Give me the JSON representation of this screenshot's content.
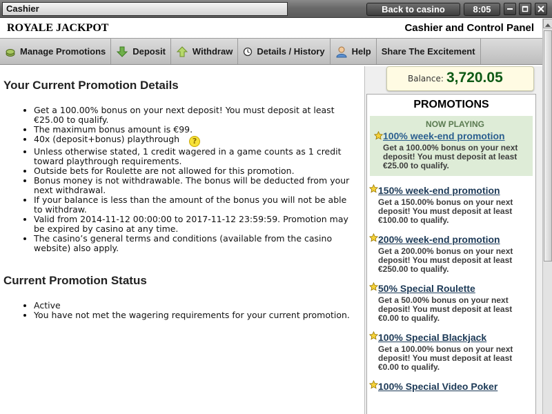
{
  "window": {
    "title": "Cashier",
    "back_button": "Back to casino",
    "time": "8:05"
  },
  "header": {
    "brand": "ROYALE JACKPOT",
    "panel_title": "Cashier and Control Panel"
  },
  "nav": {
    "items": [
      {
        "label": "Manage Promotions",
        "icon": "coins-icon"
      },
      {
        "label": "Deposit",
        "icon": "arrow-down-icon"
      },
      {
        "label": "Withdraw",
        "icon": "arrow-up-icon"
      },
      {
        "label": "Details / History",
        "icon": "clock-icon"
      },
      {
        "label": "Help",
        "icon": "person-help-icon"
      },
      {
        "label": "Share The Excitement",
        "icon": ""
      }
    ]
  },
  "main": {
    "current_heading": "Your Current Promotion Details",
    "details": [
      "Get a 100.00% bonus on your next deposit! You must deposit at least €25.00 to qualify.",
      "The maximum bonus amount is €99.",
      "40x (deposit+bonus) playthrough",
      "Unless otherwise stated, 1 credit wagered in a game counts as 1 credit toward playthrough requirements.",
      "Outside bets for Roulette are not allowed for this promotion.",
      "Bonus money is not withdrawable. The bonus will be deducted from your next withdrawal.",
      "If your balance is less than the amount of the bonus you will not be able to withdraw.",
      "Valid from 2014-11-12 00:00:00 to 2017-11-12 23:59:59. Promotion may be expired by casino at any time.",
      "The casino’s general terms and conditions (available from the casino website) also apply."
    ],
    "playthrough_help": "?",
    "status_heading": "Current Promotion Status",
    "status": [
      "Active",
      "You have not met the wagering requirements for your current promotion."
    ]
  },
  "sidebar": {
    "balance_label": "Balance:",
    "balance_value": "3,720.05",
    "promotions_title": "PROMOTIONS",
    "now_playing": "NOW PLAYING",
    "promotions": [
      {
        "name": "100% week-end promotion",
        "desc": "Get a 100.00% bonus on your next deposit! You must deposit at least €25.00 to qualify."
      },
      {
        "name": "150% week-end promotion",
        "desc": "Get a 150.00% bonus on your next deposit! You must deposit at least €100.00 to qualify."
      },
      {
        "name": "200% week-end promotion",
        "desc": "Get a 200.00% bonus on your next deposit! You must deposit at least €250.00 to qualify."
      },
      {
        "name": "50% Special Roulette",
        "desc": "Get a 50.00% bonus on your next deposit! You must deposit at least €0.00 to qualify."
      },
      {
        "name": "100% Special Blackjack",
        "desc": "Get a 100.00% bonus on your next deposit! You must deposit at least €0.00 to qualify."
      },
      {
        "name": "100% Special Video Poker",
        "desc": ""
      }
    ]
  },
  "colors": {
    "balance_value": "#0e5a16",
    "now_playing_bg": "#deecd7",
    "promo_link": "#1d3a57"
  }
}
